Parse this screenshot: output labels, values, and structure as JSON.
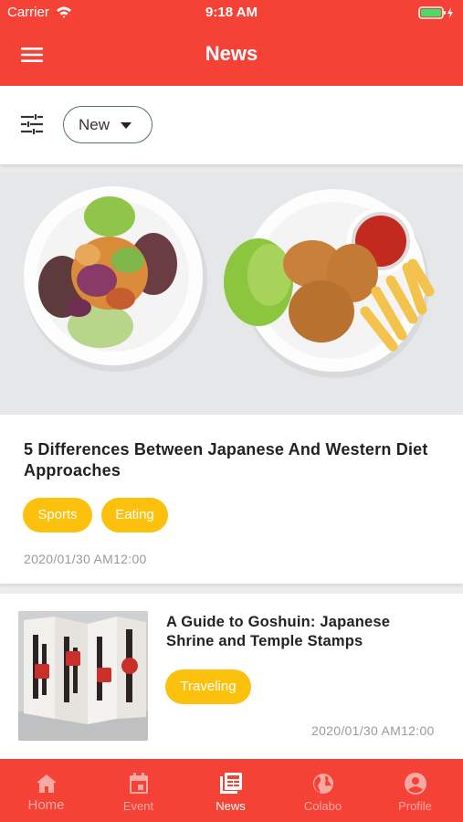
{
  "status_bar": {
    "carrier": "Carrier",
    "time": "9:18 AM"
  },
  "header": {
    "title": "News",
    "menu_icon": "hamburger-menu-icon"
  },
  "filter_bar": {
    "filter_icon": "sliders-icon",
    "sort_value": "New"
  },
  "articles": [
    {
      "title": "5 Differences Between Japanese And Western Diet Approaches",
      "tags": [
        "Sports",
        "Eating"
      ],
      "date": "2020/01/30 AM12:00"
    },
    {
      "title": "A Guide to Goshuin: Japanese Shrine and Temple Stamps",
      "tags": [
        "Traveling"
      ],
      "date": "2020/01/30 AM12:00"
    }
  ],
  "tabs": [
    {
      "label": "Home",
      "icon": "home-icon"
    },
    {
      "label": "Event",
      "icon": "calendar-icon"
    },
    {
      "label": "News",
      "icon": "newspaper-icon",
      "active": true
    },
    {
      "label": "Colabo",
      "icon": "globe-icon"
    },
    {
      "label": "Profile",
      "icon": "profile-icon"
    }
  ],
  "colors": {
    "brand": "#f44236",
    "tag": "#fcc10d"
  }
}
